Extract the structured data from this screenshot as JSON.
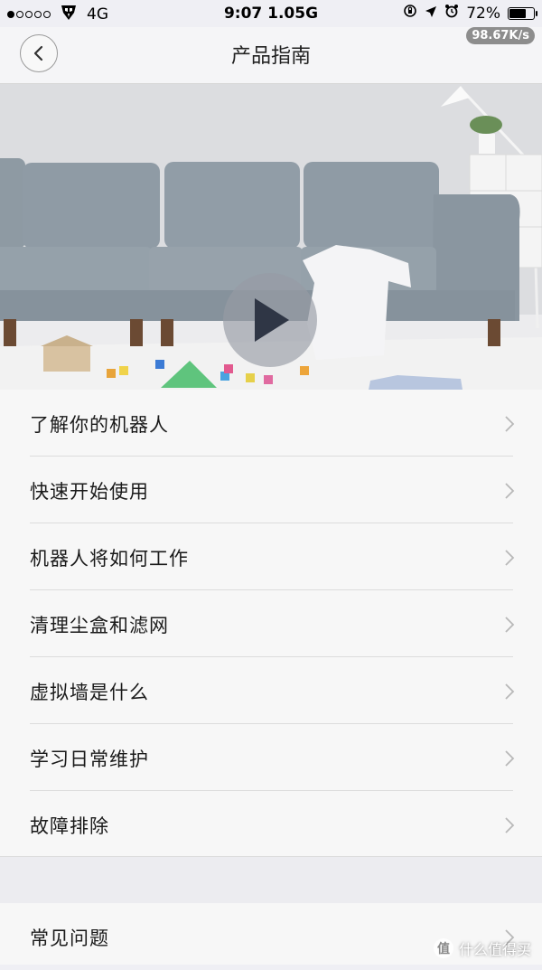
{
  "status_bar": {
    "signal_dots_filled": 1,
    "signal_dots_total": 5,
    "carrier_icon": "transformers-autobot-icon",
    "network": "4G",
    "time": "9:07 1.05G",
    "battery_percent": "72%",
    "battery_level": 0.72
  },
  "nav": {
    "title": "产品指南",
    "speed_badge": "98.67K/s"
  },
  "hero": {
    "media": "living-room-sofa-video-thumbnail",
    "play_icon": "play-icon"
  },
  "menu": {
    "items": [
      {
        "label": "了解你的机器人"
      },
      {
        "label": "快速开始使用"
      },
      {
        "label": "机器人将如何工作"
      },
      {
        "label": "清理尘盒和滤网"
      },
      {
        "label": "虚拟墙是什么"
      },
      {
        "label": "学习日常维护"
      },
      {
        "label": "故障排除"
      }
    ],
    "faq": {
      "label": "常见问题"
    }
  },
  "watermark": {
    "logo_text": "值",
    "text": "什么值得买"
  },
  "colors": {
    "background": "#efeff4",
    "list_bg": "#f7f7f7",
    "divider": "#dcdcdc",
    "chevron": "#b8b8b8"
  }
}
